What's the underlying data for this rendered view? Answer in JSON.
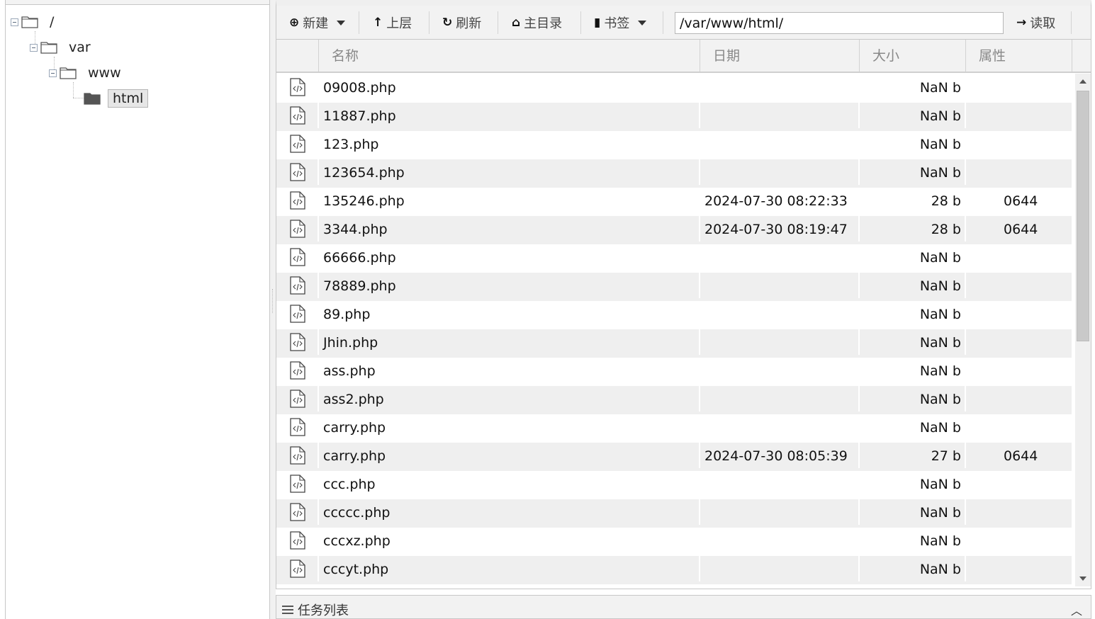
{
  "tree": {
    "root": {
      "label": "/"
    },
    "var": {
      "label": "var"
    },
    "www": {
      "label": "www"
    },
    "html": {
      "label": "html"
    }
  },
  "toolbar": {
    "new_label": "新建",
    "up_label": "上层",
    "refresh_label": "刷新",
    "home_label": "主目录",
    "bookmark_label": "书签",
    "path_value": "/var/www/html/",
    "read_label": "读取"
  },
  "columns": {
    "name": "名称",
    "date": "日期",
    "size": "大小",
    "attr": "属性"
  },
  "files": [
    {
      "name": "09008.php",
      "date": "",
      "size": "NaN b",
      "attr": ""
    },
    {
      "name": "11887.php",
      "date": "",
      "size": "NaN b",
      "attr": ""
    },
    {
      "name": "123.php",
      "date": "",
      "size": "NaN b",
      "attr": ""
    },
    {
      "name": "123654.php",
      "date": "",
      "size": "NaN b",
      "attr": ""
    },
    {
      "name": "135246.php",
      "date": "2024-07-30 08:22:33",
      "size": "28 b",
      "attr": "0644"
    },
    {
      "name": "3344.php",
      "date": "2024-07-30 08:19:47",
      "size": "28 b",
      "attr": "0644"
    },
    {
      "name": "66666.php",
      "date": "",
      "size": "NaN b",
      "attr": ""
    },
    {
      "name": "78889.php",
      "date": "",
      "size": "NaN b",
      "attr": ""
    },
    {
      "name": "89.php",
      "date": "",
      "size": "NaN b",
      "attr": ""
    },
    {
      "name": "Jhin.php",
      "date": "",
      "size": "NaN b",
      "attr": ""
    },
    {
      "name": "ass.php",
      "date": "",
      "size": "NaN b",
      "attr": ""
    },
    {
      "name": "ass2.php",
      "date": "",
      "size": "NaN b",
      "attr": ""
    },
    {
      "name": "carry.php",
      "date": "",
      "size": "NaN b",
      "attr": ""
    },
    {
      "name": "carry.php",
      "date": "2024-07-30 08:05:39",
      "size": "27 b",
      "attr": "0644"
    },
    {
      "name": "ccc.php",
      "date": "",
      "size": "NaN b",
      "attr": ""
    },
    {
      "name": "ccccc.php",
      "date": "",
      "size": "NaN b",
      "attr": ""
    },
    {
      "name": "cccxz.php",
      "date": "",
      "size": "NaN b",
      "attr": ""
    },
    {
      "name": "cccyt.php",
      "date": "",
      "size": "NaN b",
      "attr": ""
    }
  ],
  "tasklist": {
    "label": "任务列表"
  },
  "icons": {
    "file": "php-file-icon",
    "folder": "folder-icon",
    "folder_open": "folder-filled-icon"
  }
}
